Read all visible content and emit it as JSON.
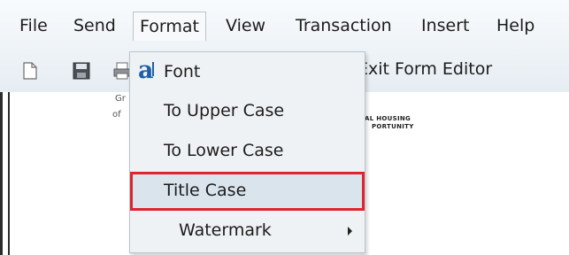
{
  "menubar": {
    "items": [
      {
        "label": "File"
      },
      {
        "label": "Send"
      },
      {
        "label": "Format"
      },
      {
        "label": "View"
      },
      {
        "label": "Transaction"
      },
      {
        "label": "Insert"
      },
      {
        "label": "Help"
      }
    ],
    "active_index": 2
  },
  "toolbar": {
    "icons": [
      "new-document-icon",
      "save-icon",
      "print-icon"
    ],
    "exit_label": "Exit Form Editor"
  },
  "document": {
    "snippets": [
      "Gr",
      "of",
      "AL HOUSING",
      "PORTUNITY"
    ]
  },
  "format_menu": {
    "items": [
      {
        "label": "Font",
        "icon": "font-icon"
      },
      {
        "label": "To Upper Case"
      },
      {
        "label": "To Lower Case"
      },
      {
        "label": "Title Case",
        "highlighted": true
      },
      {
        "label": "Watermark",
        "has_submenu": true
      }
    ],
    "font_icon_glyph": "a"
  },
  "colors": {
    "highlight_border": "#e0242c",
    "highlight_fill": "#d9e4ec",
    "menu_bg": "#eef2f4",
    "font_icon": "#1f5fa8"
  }
}
